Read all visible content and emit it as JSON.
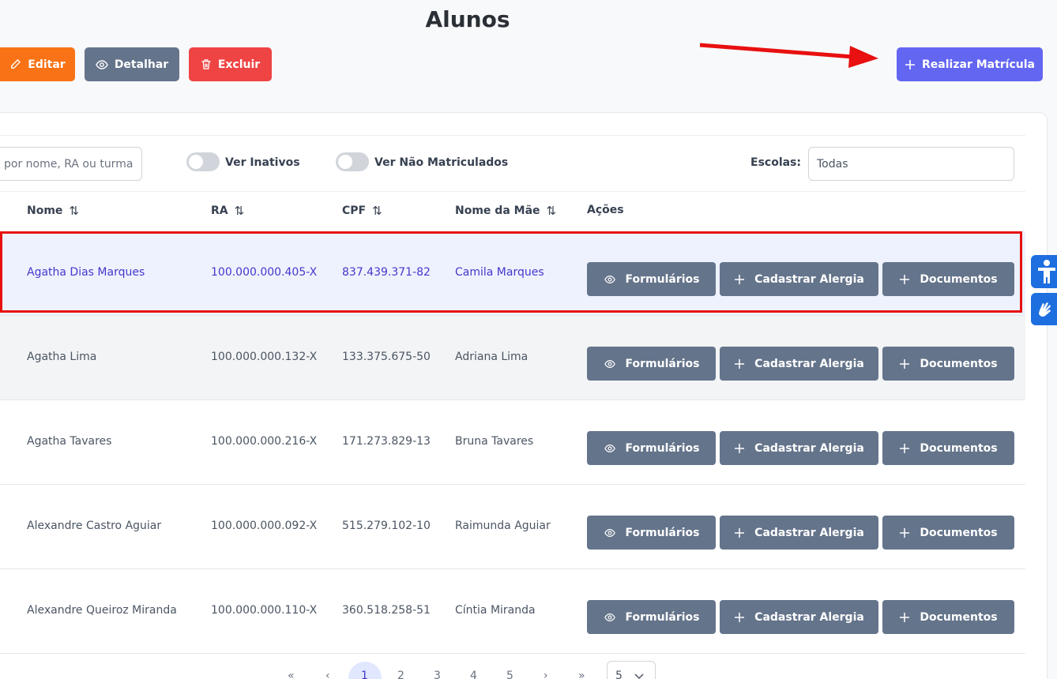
{
  "page": {
    "title": "Alunos"
  },
  "toolbar": {
    "edit_label": "Editar",
    "detail_label": "Detalhar",
    "delete_label": "Excluir",
    "enroll_label": "Realizar Matrícula"
  },
  "filters": {
    "search_placeholder": "por nome, RA ou turma",
    "inactive_label": "Ver Inativos",
    "not_enrolled_label": "Ver Não Matriculados",
    "schools_label": "Escolas:",
    "schools_value": "Todas"
  },
  "table": {
    "columns": [
      "Nome",
      "RA",
      "CPF",
      "Nome da Mãe",
      "Ações"
    ],
    "action_labels": [
      "Formulários",
      "Cadastrar Alergia",
      "Documentos"
    ],
    "rows": [
      {
        "name": "Agatha Dias Marques",
        "ra": "100.000.000.405-X",
        "cpf": "837.439.371-82",
        "mother": "Camila Marques"
      },
      {
        "name": "Agatha Lima",
        "ra": "100.000.000.132-X",
        "cpf": "133.375.675-50",
        "mother": "Adriana Lima"
      },
      {
        "name": "Agatha Tavares",
        "ra": "100.000.000.216-X",
        "cpf": "171.273.829-13",
        "mother": "Bruna Tavares"
      },
      {
        "name": "Alexandre Castro Aguiar",
        "ra": "100.000.000.092-X",
        "cpf": "515.279.102-10",
        "mother": "Raimunda Aguiar"
      },
      {
        "name": "Alexandre Queiroz Miranda",
        "ra": "100.000.000.110-X",
        "cpf": "360.518.258-51",
        "mother": "Cíntia Miranda"
      }
    ]
  },
  "pagination": {
    "first": "«",
    "prev": "‹",
    "pages": [
      "1",
      "2",
      "3",
      "4",
      "5"
    ],
    "current": "1",
    "next": "›",
    "last": "»",
    "page_size": "5"
  },
  "colors": {
    "enroll": "#6366f1",
    "edit": "#f97316",
    "delete": "#ef4444",
    "neutral": "#64748b",
    "highlight": "#e81010"
  },
  "icons": {
    "edit": "pencil-icon",
    "detail": "eye-icon",
    "delete": "trash-icon",
    "enroll": "plus-icon",
    "accessibility": "accessibility-person-icon",
    "sign_language": "sign-language-hands-icon"
  }
}
